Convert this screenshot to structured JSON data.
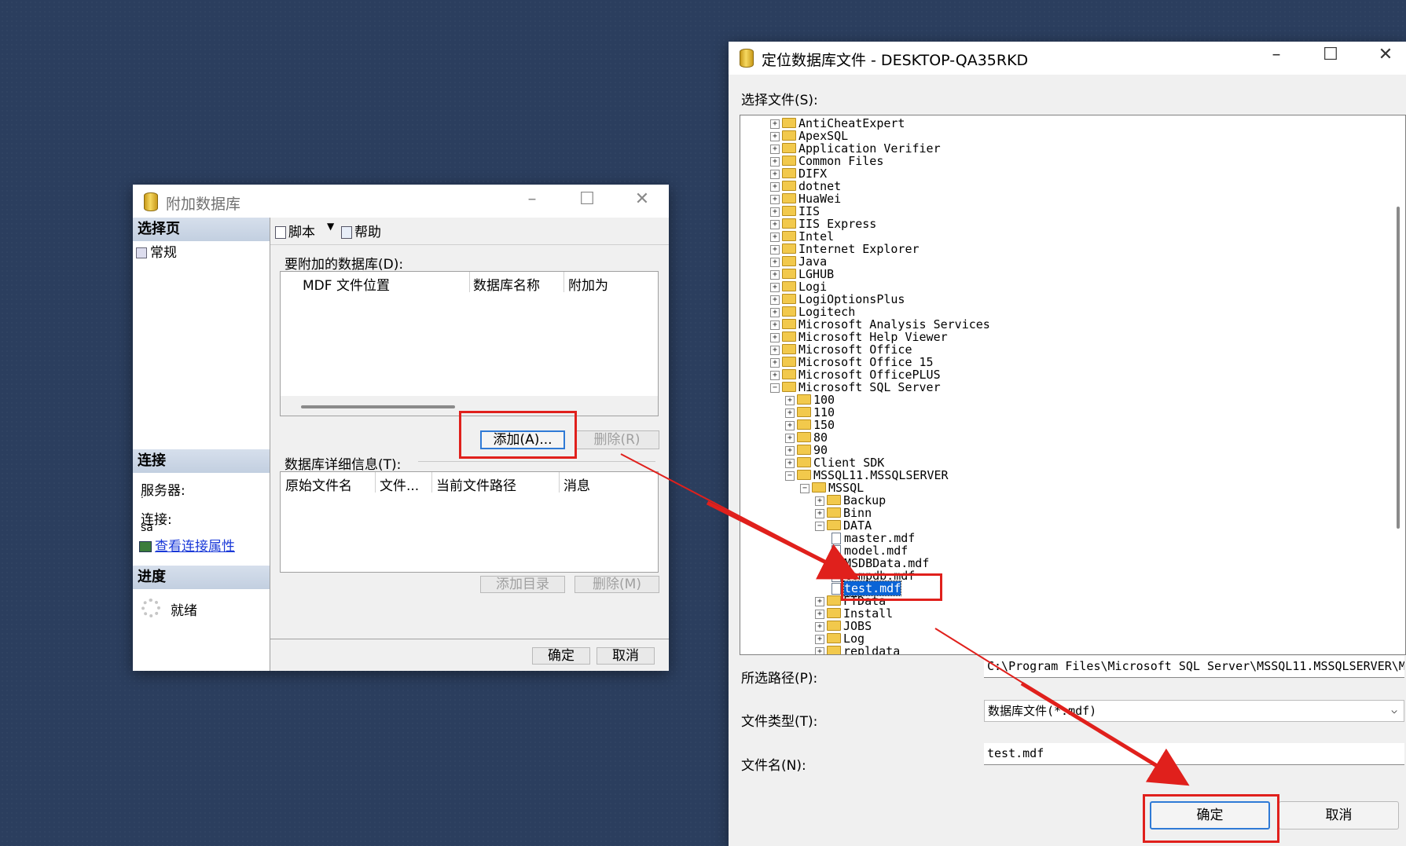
{
  "attach_dialog": {
    "title": "附加数据库",
    "select_page_header": "选择页",
    "page_general": "常规",
    "connection_header": "连接",
    "server_label": "服务器:",
    "server_value": ".",
    "connect_label": "连接:",
    "connect_value": "sa",
    "view_conn_props": "查看连接属性",
    "progress_header": "进度",
    "progress_status": "就绪",
    "toolbar_script": "脚本",
    "toolbar_help": "帮助",
    "db_to_attach_label": "要附加的数据库(D):",
    "attach_columns": [
      "MDF 文件位置",
      "数据库名称",
      "附加为"
    ],
    "add_button": "添加(A)...",
    "remove_button": "删除(R)",
    "details_label": "数据库详细信息(T):",
    "details_columns": [
      "原始文件名",
      "文件...",
      "当前文件路径",
      "消息"
    ],
    "add_catalog_button": "添加目录",
    "remove_m_button": "删除(M)",
    "ok_button": "确定",
    "cancel_button": "取消"
  },
  "locate_dialog": {
    "title": "定位数据库文件 - DESKTOP-QA35RKD",
    "select_file_label": "选择文件(S):",
    "tree": [
      {
        "level": 0,
        "type": "folder",
        "expanded": false,
        "label": "AntiCheatExpert"
      },
      {
        "level": 0,
        "type": "folder",
        "expanded": false,
        "label": "ApexSQL"
      },
      {
        "level": 0,
        "type": "folder",
        "expanded": false,
        "label": "Application Verifier"
      },
      {
        "level": 0,
        "type": "folder",
        "expanded": false,
        "label": "Common Files"
      },
      {
        "level": 0,
        "type": "folder",
        "expanded": false,
        "label": "DIFX"
      },
      {
        "level": 0,
        "type": "folder",
        "expanded": false,
        "label": "dotnet"
      },
      {
        "level": 0,
        "type": "folder",
        "expanded": false,
        "label": "HuaWei"
      },
      {
        "level": 0,
        "type": "folder",
        "expanded": false,
        "label": "IIS"
      },
      {
        "level": 0,
        "type": "folder",
        "expanded": false,
        "label": "IIS Express"
      },
      {
        "level": 0,
        "type": "folder",
        "expanded": false,
        "label": "Intel"
      },
      {
        "level": 0,
        "type": "folder",
        "expanded": false,
        "label": "Internet Explorer"
      },
      {
        "level": 0,
        "type": "folder",
        "expanded": false,
        "label": "Java"
      },
      {
        "level": 0,
        "type": "folder",
        "expanded": false,
        "label": "LGHUB"
      },
      {
        "level": 0,
        "type": "folder",
        "expanded": false,
        "label": "Logi"
      },
      {
        "level": 0,
        "type": "folder",
        "expanded": false,
        "label": "LogiOptionsPlus"
      },
      {
        "level": 0,
        "type": "folder",
        "expanded": false,
        "label": "Logitech"
      },
      {
        "level": 0,
        "type": "folder",
        "expanded": false,
        "label": "Microsoft Analysis Services"
      },
      {
        "level": 0,
        "type": "folder",
        "expanded": false,
        "label": "Microsoft Help Viewer"
      },
      {
        "level": 0,
        "type": "folder",
        "expanded": false,
        "label": "Microsoft Office"
      },
      {
        "level": 0,
        "type": "folder",
        "expanded": false,
        "label": "Microsoft Office 15"
      },
      {
        "level": 0,
        "type": "folder",
        "expanded": false,
        "label": "Microsoft OfficePLUS"
      },
      {
        "level": 0,
        "type": "folder",
        "expanded": true,
        "label": "Microsoft SQL Server"
      },
      {
        "level": 1,
        "type": "folder",
        "expanded": false,
        "label": "100"
      },
      {
        "level": 1,
        "type": "folder",
        "expanded": false,
        "label": "110"
      },
      {
        "level": 1,
        "type": "folder",
        "expanded": false,
        "label": "150"
      },
      {
        "level": 1,
        "type": "folder",
        "expanded": false,
        "label": "80"
      },
      {
        "level": 1,
        "type": "folder",
        "expanded": false,
        "label": "90"
      },
      {
        "level": 1,
        "type": "folder",
        "expanded": false,
        "label": "Client SDK"
      },
      {
        "level": 1,
        "type": "folder",
        "expanded": true,
        "label": "MSSQL11.MSSQLSERVER"
      },
      {
        "level": 2,
        "type": "folder",
        "expanded": true,
        "label": "MSSQL"
      },
      {
        "level": 3,
        "type": "folder",
        "expanded": false,
        "label": "Backup"
      },
      {
        "level": 3,
        "type": "folder",
        "expanded": false,
        "label": "Binn"
      },
      {
        "level": 3,
        "type": "folder",
        "expanded": true,
        "label": "DATA"
      },
      {
        "level": 4,
        "type": "file",
        "label": "master.mdf"
      },
      {
        "level": 4,
        "type": "file",
        "label": "model.mdf"
      },
      {
        "level": 4,
        "type": "file",
        "label": "MSDBData.mdf"
      },
      {
        "level": 4,
        "type": "file",
        "label": "tempdb.mdf"
      },
      {
        "level": 4,
        "type": "file",
        "label": "test.mdf",
        "selected": true
      },
      {
        "level": 3,
        "type": "folder",
        "expanded": false,
        "label": "FTData"
      },
      {
        "level": 3,
        "type": "folder",
        "expanded": false,
        "label": "Install"
      },
      {
        "level": 3,
        "type": "folder",
        "expanded": false,
        "label": "JOBS"
      },
      {
        "level": 3,
        "type": "folder",
        "expanded": false,
        "label": "Log"
      },
      {
        "level": 3,
        "type": "folder",
        "expanded": false,
        "label": "repldata"
      }
    ],
    "selected_path_label": "所选路径(P):",
    "selected_path_value": "C:\\Program Files\\Microsoft SQL Server\\MSSQL11.MSSQLSERVER\\M",
    "file_type_label": "文件类型(T):",
    "file_type_value": "数据库文件(*.mdf)",
    "file_name_label": "文件名(N):",
    "file_name_value": "test.mdf",
    "ok_button": "确定",
    "cancel_button": "取消"
  },
  "colors": {
    "highlight_red": "#e0201c",
    "selection_blue": "#0a64d6",
    "desktop_bg": "#2b3e5e"
  }
}
